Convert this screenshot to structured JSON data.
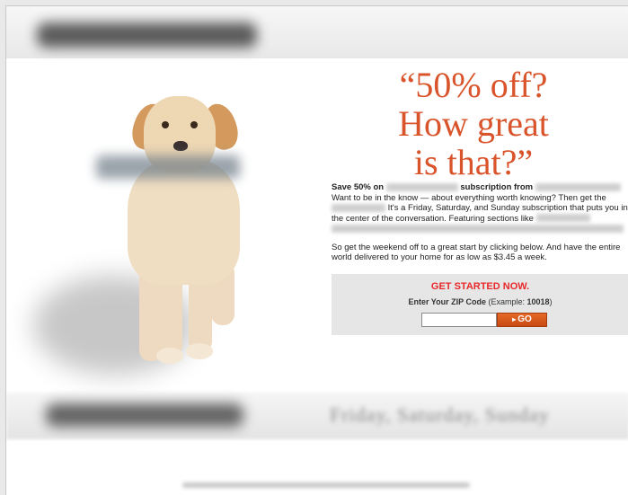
{
  "headline": {
    "line1": "“50% off?",
    "line2": "How great",
    "line3": "is that?”"
  },
  "offer": {
    "save_text": "Save 50% on",
    "subscription_from": "subscription from",
    "want_text": "Want to be in the know — about everything worth knowing? Then get the",
    "friday_text": "It's a Friday, Saturday, and Sunday subscription that puts you in the center of the conversation. Featuring sections like",
    "para2": "So get the weekend off to a great start by clicking below. And have the entire world delivered to your home for as low as $3.45 a week."
  },
  "cta": {
    "title": "GET STARTED NOW.",
    "zip_label": "Enter Your ZIP Code",
    "zip_example_prefix": "(Example: ",
    "zip_example_value": "10018",
    "zip_example_suffix": ")",
    "zip_value": "",
    "go_label": "GO",
    "go_arrow": "▸"
  },
  "footer": {
    "tagline": "Friday, Saturday, Sunday"
  },
  "colors": {
    "headline": "#d9532b",
    "cta_title": "#e8282a",
    "go_button": "#d85a1c"
  }
}
